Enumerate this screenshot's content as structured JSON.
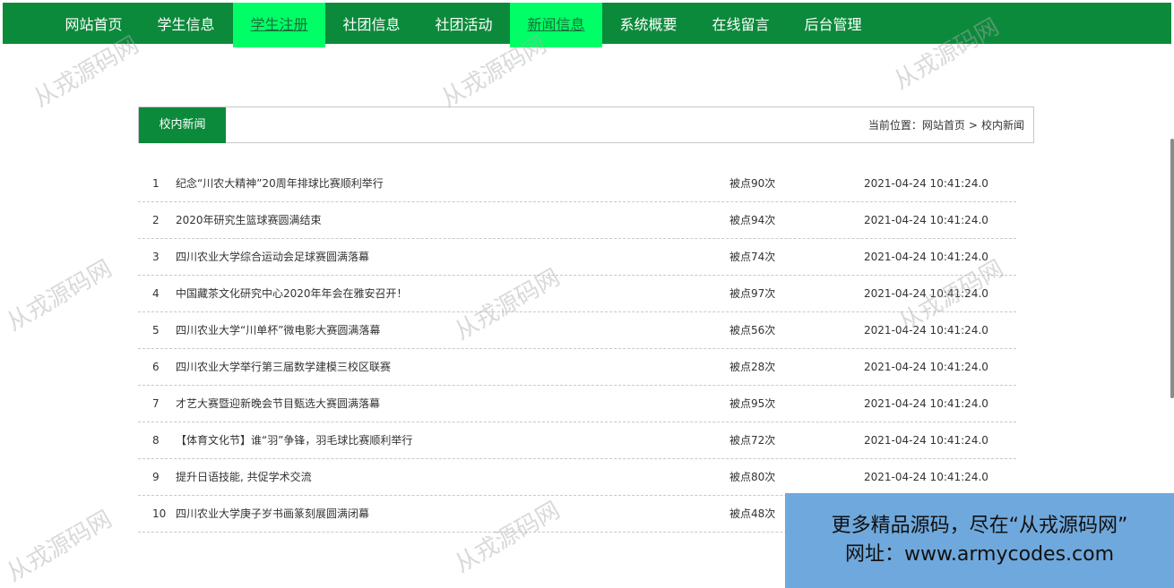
{
  "nav": {
    "items": [
      {
        "label": "网站首页",
        "active": false
      },
      {
        "label": "学生信息",
        "active": false
      },
      {
        "label": "学生注册",
        "active": true
      },
      {
        "label": "社团信息",
        "active": false
      },
      {
        "label": "社团活动",
        "active": false
      },
      {
        "label": "新闻信息",
        "active": true
      },
      {
        "label": "系统概要",
        "active": false
      },
      {
        "label": "在线留言",
        "active": false
      },
      {
        "label": "后台管理",
        "active": false
      }
    ]
  },
  "section": {
    "tab_label": "校内新闻",
    "breadcrumb_prefix": "当前位置：",
    "breadcrumb_home": "网站首页",
    "breadcrumb_sep": ">",
    "breadcrumb_current": "校内新闻"
  },
  "news": [
    {
      "no": "1",
      "title": "纪念“川农大精神”20周年排球比赛顺利举行",
      "views": "被点90次",
      "date": "2021-04-24 10:41:24.0"
    },
    {
      "no": "2",
      "title": "2020年研究生篮球赛圆满结束",
      "views": "被点94次",
      "date": "2021-04-24 10:41:24.0"
    },
    {
      "no": "3",
      "title": "四川农业大学综合运动会足球赛圆满落幕",
      "views": "被点74次",
      "date": "2021-04-24 10:41:24.0"
    },
    {
      "no": "4",
      "title": "中国藏茶文化研究中心2020年年会在雅安召开！",
      "views": "被点97次",
      "date": "2021-04-24 10:41:24.0"
    },
    {
      "no": "5",
      "title": "四川农业大学“川单杯”微电影大赛圆满落幕",
      "views": "被点56次",
      "date": "2021-04-24 10:41:24.0"
    },
    {
      "no": "6",
      "title": "四川农业大学举行第三届数学建模三校区联赛",
      "views": "被点28次",
      "date": "2021-04-24 10:41:24.0"
    },
    {
      "no": "7",
      "title": "才艺大赛暨迎新晚会节目甄选大赛圆满落幕",
      "views": "被点95次",
      "date": "2021-04-24 10:41:24.0"
    },
    {
      "no": "8",
      "title": "【体育文化节】谁“羽”争锋，羽毛球比赛顺利举行",
      "views": "被点72次",
      "date": "2021-04-24 10:41:24.0"
    },
    {
      "no": "9",
      "title": "提升日语技能, 共促学术交流",
      "views": "被点80次",
      "date": "2021-04-24 10:41:24.0"
    },
    {
      "no": "10",
      "title": "四川农业大学庚子岁书画篆刻展圆满闭幕",
      "views": "被点48次",
      "date": ""
    }
  ],
  "watermark_text": "从戎源码网",
  "promo": {
    "line1": "更多精品源码，尽在“从戎源码网”",
    "line2": "网址：www.armycodes.com"
  },
  "colors": {
    "nav_bg": "#0c8a3b",
    "nav_active": "#00ff66",
    "promo_bg": "#6fa8dc"
  }
}
